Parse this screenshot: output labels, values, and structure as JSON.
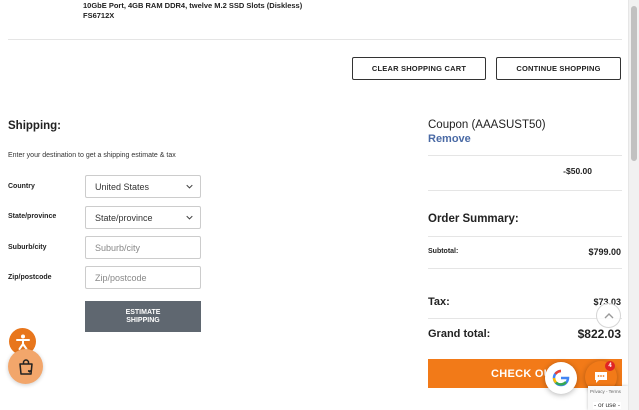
{
  "product": {
    "description": "10GbE Port, 4GB RAM DDR4, twelve M.2 SSD Slots (Diskless)",
    "sku": "FS6712X"
  },
  "cart_actions": {
    "clear_label": "CLEAR SHOPPING CART",
    "continue_label": "CONTINUE SHOPPING"
  },
  "shipping": {
    "title": "Shipping:",
    "hint": "Enter your destination to get a shipping estimate & tax",
    "country_label": "Country",
    "country_value": "United States",
    "state_label": "State/province",
    "state_value": "State/province",
    "city_label": "Suburb/city",
    "city_placeholder": "Suburb/city",
    "zip_label": "Zip/postcode",
    "zip_placeholder": "Zip/postcode",
    "estimate_label_line1": "ESTIMATE",
    "estimate_label_line2": "SHIPPING"
  },
  "coupon": {
    "title": "Coupon (AAASUST50)",
    "remove_label": "Remove",
    "amount": "-$50.00"
  },
  "summary": {
    "title": "Order Summary:",
    "subtotal_label": "Subtotal:",
    "subtotal_value": "$799.00",
    "tax_label": "Tax:",
    "tax_value": "$73.03",
    "grand_label": "Grand total:",
    "grand_value": "$822.03",
    "checkout_label": "CHECK OUT"
  },
  "widgets": {
    "chat_badge_count": "4",
    "recaptcha_text": "Privacy - Terms",
    "or_use_text": "- or use -"
  },
  "colors": {
    "accent_orange": "#f27a18",
    "remove_link_blue": "#4a6aa5",
    "estimate_button_gray": "#5f6770"
  }
}
